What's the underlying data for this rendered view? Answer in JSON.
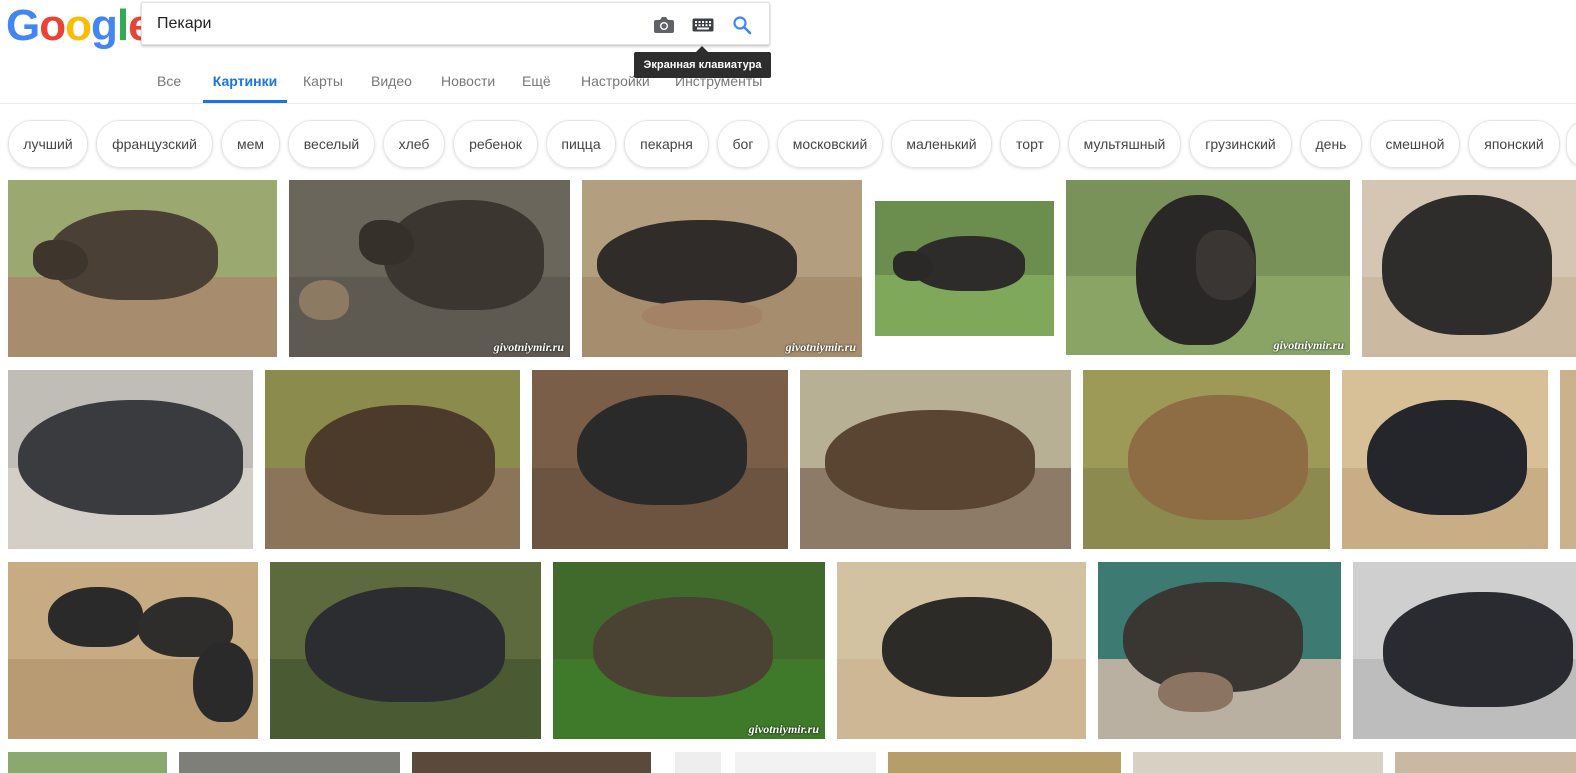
{
  "logo": "Google",
  "search": {
    "query": "Пекари",
    "camera_icon": "camera-icon",
    "keyboard_icon": "keyboard-icon",
    "search_icon": "search-icon",
    "tooltip": "Экранная клавиатура"
  },
  "tabs": [
    {
      "label": "Все"
    },
    {
      "label": "Картинки",
      "active": true
    },
    {
      "label": "Карты"
    },
    {
      "label": "Видео"
    },
    {
      "label": "Новости"
    },
    {
      "label": "Ещё"
    },
    {
      "label": "Настройки"
    },
    {
      "label": "Инструменты"
    }
  ],
  "chips": [
    "лучший",
    "французский",
    "мем",
    "веселый",
    "хлеб",
    "ребенок",
    "пицца",
    "пекарня",
    "бог",
    "московский",
    "маленький",
    "торт",
    "мультяшный",
    "грузинский",
    "день",
    "смешной",
    "японский"
  ],
  "watermark": "givotniymir.ru",
  "colors": {
    "accent": "#1a73e8",
    "tab_inactive": "#777777",
    "tooltip_bg": "#2d2d2d"
  }
}
